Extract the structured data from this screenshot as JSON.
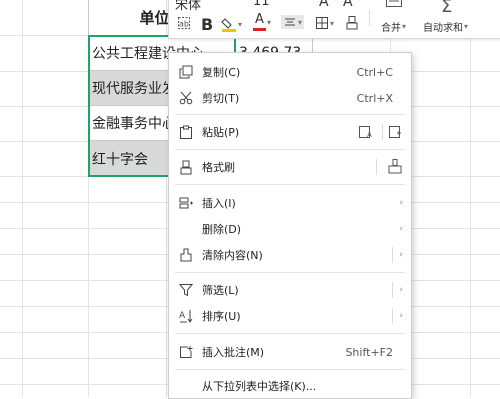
{
  "sheet": {
    "header_cell": "单位名",
    "rows": [
      {
        "name": "公共工程建设中心",
        "value": "3,469.73"
      },
      {
        "name": "现代服务业发展"
      },
      {
        "name": "金融事务中心"
      },
      {
        "name": "红十字会"
      }
    ]
  },
  "toolbar": {
    "font_name": "宋体",
    "font_size": "11",
    "bold_label": "B",
    "font_color_label": "A",
    "merge_label": "合并",
    "autosum_label": "自动求和"
  },
  "context_menu": {
    "items": [
      {
        "label": "复制(C)",
        "shortcut": "Ctrl+C",
        "icon": "copy-icon"
      },
      {
        "label": "剪切(T)",
        "shortcut": "Ctrl+X",
        "icon": "cut-icon"
      },
      {
        "label": "粘贴(P)",
        "icon": "paste-icon"
      },
      {
        "label": "格式刷",
        "icon": "format-painter-icon"
      },
      {
        "label": "插入(I)",
        "icon": "insert-icon"
      },
      {
        "label": "删除(D)"
      },
      {
        "label": "清除内容(N)",
        "icon": "clear-icon"
      },
      {
        "label": "筛选(L)",
        "icon": "filter-icon"
      },
      {
        "label": "排序(U)",
        "icon": "sort-icon"
      },
      {
        "label": "插入批注(M)",
        "shortcut": "Shift+F2",
        "icon": "comment-icon"
      },
      {
        "label": "从下拉列表中选择(K)..."
      }
    ]
  },
  "colors": {
    "selection_border": "#21a366",
    "fill_gray": "#d9d9d9",
    "font_color_red": "#e02020",
    "highlight_yellow": "#f5c400"
  }
}
